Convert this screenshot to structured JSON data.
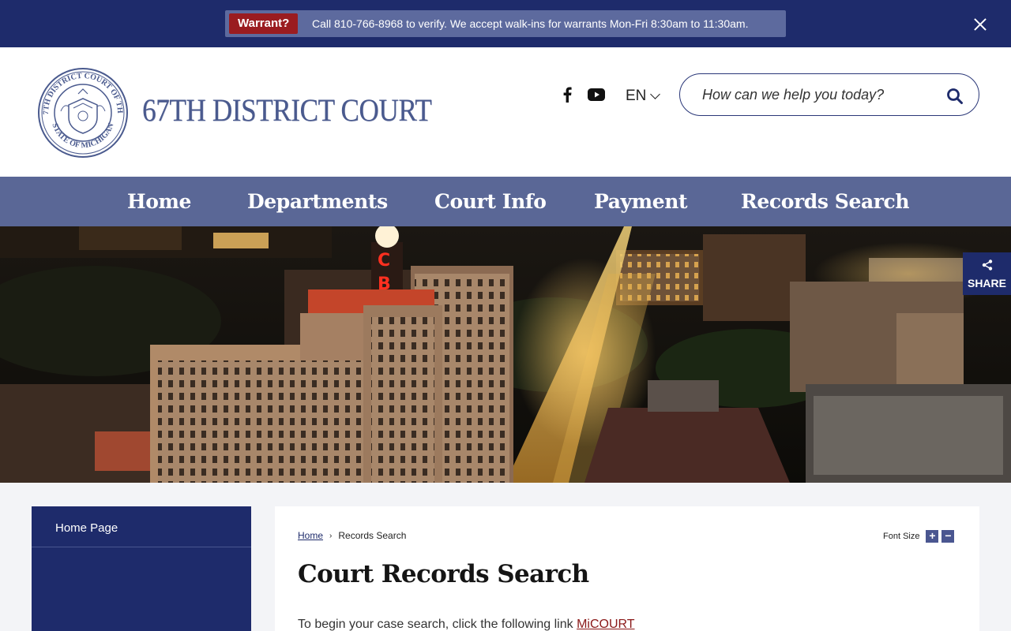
{
  "alert": {
    "badge": "Warrant?",
    "message": "Call 810-766-8968 to verify. We accept walk-ins for warrants Mon-Fri 8:30am to 11:30am."
  },
  "header": {
    "site_title": "67TH DISTRICT COURT",
    "seal_text_top": "67TH DISTRICT COURT OF THE",
    "seal_text_bottom": "STATE OF MICHIGAN",
    "language": "EN",
    "search_placeholder": "How can we help you today?"
  },
  "nav": {
    "items": [
      {
        "label": "Home"
      },
      {
        "label": "Departments"
      },
      {
        "label": "Court Info"
      },
      {
        "label": "Payment"
      },
      {
        "label": "Records Search"
      }
    ]
  },
  "hero": {
    "share_label": "SHARE"
  },
  "sidebar": {
    "items": [
      {
        "label": "Home Page"
      }
    ]
  },
  "main": {
    "breadcrumb": {
      "home": "Home",
      "separator": "›",
      "current": "Records Search"
    },
    "font_size_label": "Font Size",
    "font_increase": "+",
    "font_decrease": "−",
    "title": "Court Records Search",
    "intro_text": "To begin your case search, click the following link ",
    "intro_link": "MiCOURT"
  },
  "colors": {
    "brand_navy": "#1e2b6b",
    "nav_bg": "#5a6796",
    "alert_red": "#9a1c20",
    "link_red": "#8a1818"
  },
  "icons": [
    "close-icon",
    "facebook-icon",
    "youtube-icon",
    "chevron-down-icon",
    "search-icon",
    "share-icon"
  ]
}
